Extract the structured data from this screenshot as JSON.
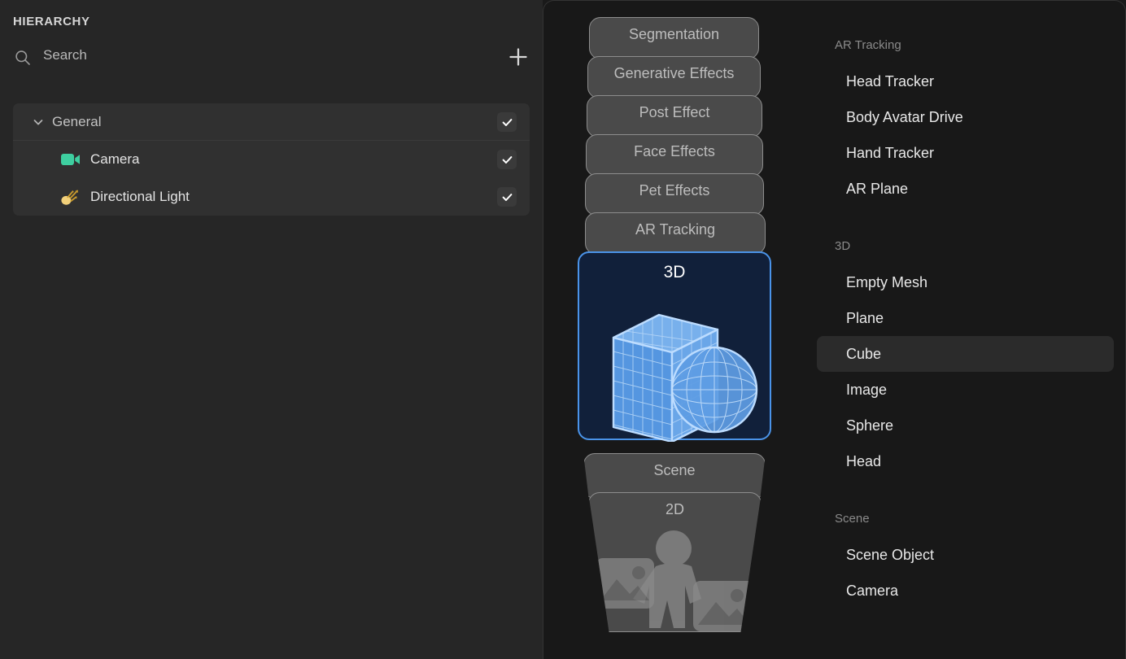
{
  "hierarchy": {
    "title": "HIERARCHY",
    "search": {
      "placeholder": "Search",
      "icon": "search-icon"
    },
    "add_button": {
      "icon": "plus-icon",
      "label": "+"
    },
    "tree": [
      {
        "type": "group",
        "label": "General",
        "expanded": true,
        "checked": true,
        "chevron": "chevron-down-icon"
      },
      {
        "type": "item",
        "label": "Camera",
        "icon": "camera-icon",
        "icon_color": "#3ecfa0",
        "checked": true
      },
      {
        "type": "item",
        "label": "Directional Light",
        "icon": "directional-light-icon",
        "icon_color": "#f2d07a",
        "checked": true
      }
    ],
    "checkmark": "✓"
  },
  "card_stack": {
    "cards": [
      {
        "label": "Segmentation",
        "selected": false
      },
      {
        "label": "Generative Effects",
        "selected": false
      },
      {
        "label": "Post Effect",
        "selected": false
      },
      {
        "label": "Face Effects",
        "selected": false
      },
      {
        "label": "Pet Effects",
        "selected": false
      },
      {
        "label": "AR Tracking",
        "selected": false
      },
      {
        "label": "3D",
        "selected": true,
        "art": "cube-sphere-wireframe"
      },
      {
        "label": "Scene",
        "selected": false
      },
      {
        "label": "2D",
        "selected": false,
        "art": "person-images"
      }
    ]
  },
  "library": {
    "sections": [
      {
        "title": "AR Tracking",
        "items": [
          {
            "label": "Head Tracker",
            "active": false
          },
          {
            "label": "Body Avatar Drive",
            "active": false
          },
          {
            "label": "Hand Tracker",
            "active": false
          },
          {
            "label": "AR Plane",
            "active": false
          }
        ]
      },
      {
        "title": "3D",
        "items": [
          {
            "label": "Empty Mesh",
            "active": false
          },
          {
            "label": "Plane",
            "active": false
          },
          {
            "label": "Cube",
            "active": true
          },
          {
            "label": "Image",
            "active": false
          },
          {
            "label": "Sphere",
            "active": false
          },
          {
            "label": "Head",
            "active": false
          }
        ]
      },
      {
        "title": "Scene",
        "items": [
          {
            "label": "Scene Object",
            "active": false
          },
          {
            "label": "Camera",
            "active": false
          }
        ]
      }
    ]
  },
  "colors": {
    "panel_left_bg": "#262626",
    "panel_dark_bg": "#181818",
    "tree_bg": "#303030",
    "accent_blue": "#4a93e8",
    "selected_card_bg": "#11203a",
    "card_bg": "#4a4a4a",
    "card_border": "#8d8d8d",
    "active_row_bg": "#2b2b2b"
  }
}
